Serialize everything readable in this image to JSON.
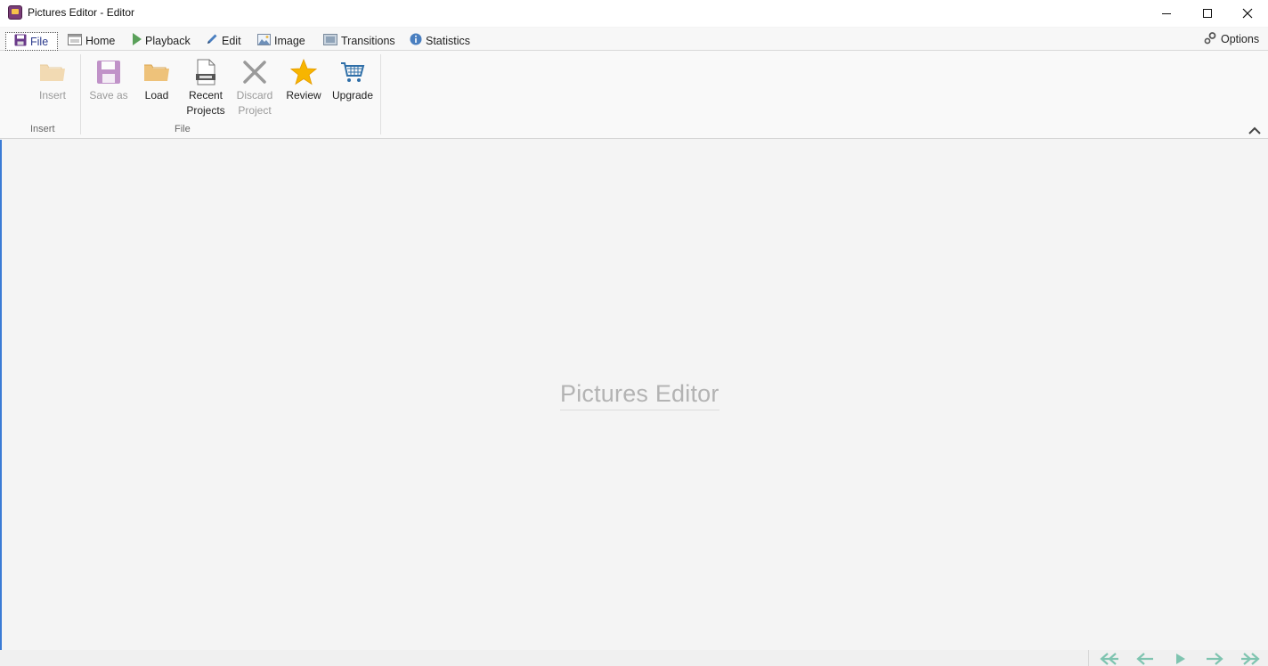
{
  "window": {
    "title": "Pictures Editor - Editor",
    "app_icon": "pictures-editor-app-icon",
    "controls": [
      "minimize",
      "maximize",
      "close"
    ]
  },
  "tabs": [
    {
      "label": "File",
      "icon": "floppy-icon",
      "selected": true
    },
    {
      "label": "Home",
      "icon": "home-window-icon"
    },
    {
      "label": "Playback",
      "icon": "play-icon"
    },
    {
      "label": "Edit",
      "icon": "pencil-icon"
    },
    {
      "label": "Image",
      "icon": "picture-icon"
    },
    {
      "label": "Transitions",
      "icon": "transitions-icon"
    },
    {
      "label": "Statistics",
      "icon": "info-icon"
    }
  ],
  "options": {
    "label": "Options",
    "icon": "gears-icon"
  },
  "ribbon": {
    "groups": [
      {
        "label": "Insert",
        "buttons": [
          {
            "label": "Insert",
            "icon": "folder-icon",
            "enabled": false
          }
        ]
      },
      {
        "label": "File",
        "buttons": [
          {
            "label": "Save as",
            "icon": "floppy-icon",
            "enabled": false
          },
          {
            "label": "Load",
            "icon": "folder-icon",
            "enabled": true
          },
          {
            "label": "Recent",
            "label2": "Projects",
            "icon": "recent-projects-icon",
            "enabled": true
          },
          {
            "label": "Discard",
            "label2": "Project",
            "icon": "x-icon",
            "enabled": false
          },
          {
            "label": "Review",
            "icon": "star-icon",
            "enabled": true
          },
          {
            "label": "Upgrade",
            "icon": "cart-icon",
            "enabled": true
          }
        ]
      }
    ]
  },
  "canvas": {
    "watermark": "Pictures Editor"
  },
  "bottom_nav": [
    "first-frame-icon",
    "previous-frame-icon",
    "play-icon",
    "next-frame-icon",
    "last-frame-icon"
  ],
  "colors": {
    "accent": "#3a7bd5",
    "file_tab_text": "#2b3a8c",
    "star": "#f7b500",
    "folder": "#eec27a",
    "floppy": "#9b4fa8",
    "nav_arrows": "#7fc4b0"
  }
}
